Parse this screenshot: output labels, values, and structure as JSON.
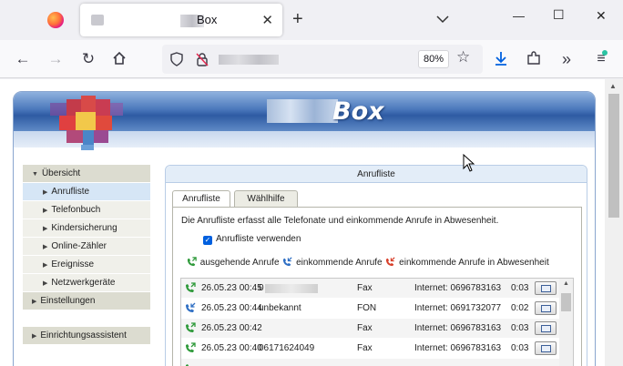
{
  "browser": {
    "tab_title": "Box",
    "zoom": "80%",
    "icons": [
      "firefox-icon",
      "close-icon",
      "plus-icon",
      "chevron-down-icon",
      "minimize-icon",
      "maximize-icon",
      "close-icon",
      "back-icon",
      "forward-icon",
      "reload-icon",
      "home-icon",
      "shield-icon",
      "lock-icon",
      "star-icon",
      "download-icon",
      "extensions-icon",
      "overflow-icon",
      "menu-icon"
    ]
  },
  "fritz": {
    "banner_title": "Box",
    "menu": [
      {
        "label": "Übersicht",
        "level": "top",
        "expanded": true
      },
      {
        "label": "Anrufliste",
        "level": "sub",
        "active": true
      },
      {
        "label": "Telefonbuch",
        "level": "sub"
      },
      {
        "label": "Kindersicherung",
        "level": "sub"
      },
      {
        "label": "Online-Zähler",
        "level": "sub"
      },
      {
        "label": "Ereignisse",
        "level": "sub"
      },
      {
        "label": "Netzwerkgeräte",
        "level": "sub"
      },
      {
        "label": "Einstellungen",
        "level": "top"
      },
      {
        "label": "Einrichtungsassistent",
        "level": "top"
      }
    ],
    "panel": {
      "title": "Anrufliste",
      "tabs": [
        "Anrufliste",
        "Wählhilfe"
      ],
      "description": "Die Anrufliste erfasst alle Telefonate und einkommende Anrufe in Abwesenheit.",
      "checkbox_label": "Anrufliste verwenden",
      "checkbox_checked": true,
      "legend": [
        "ausgehende Anrufe",
        "einkommende Anrufe",
        "einkommende Anrufe in Abwesenheit"
      ]
    },
    "calls": [
      {
        "type": "outgoing",
        "datetime": "26.05.23 00:45",
        "number": "0",
        "port": "Fax",
        "ext": "Internet: 0696783163",
        "duration": "0:03"
      },
      {
        "type": "incoming",
        "datetime": "26.05.23 00:44",
        "number": "unbekannt",
        "port": "FON",
        "ext": "Internet: 0691732077",
        "duration": "0:02"
      },
      {
        "type": "outgoing",
        "datetime": "26.05.23 00:42",
        "number": "",
        "port": "Fax",
        "ext": "Internet: 0696783163",
        "duration": "0:03"
      },
      {
        "type": "outgoing",
        "datetime": "26.05.23 00:40",
        "number": "06171624049",
        "port": "Fax",
        "ext": "Internet: 0696783163",
        "duration": "0:03"
      },
      {
        "type": "outgoing",
        "datetime": "",
        "number": "",
        "port": "",
        "ext": "",
        "duration": ""
      }
    ],
    "colors": {
      "outgoing": "#2e9a3a",
      "incoming": "#2f6fc4",
      "missed": "#d8402b",
      "banner": "#4a77bb"
    }
  }
}
